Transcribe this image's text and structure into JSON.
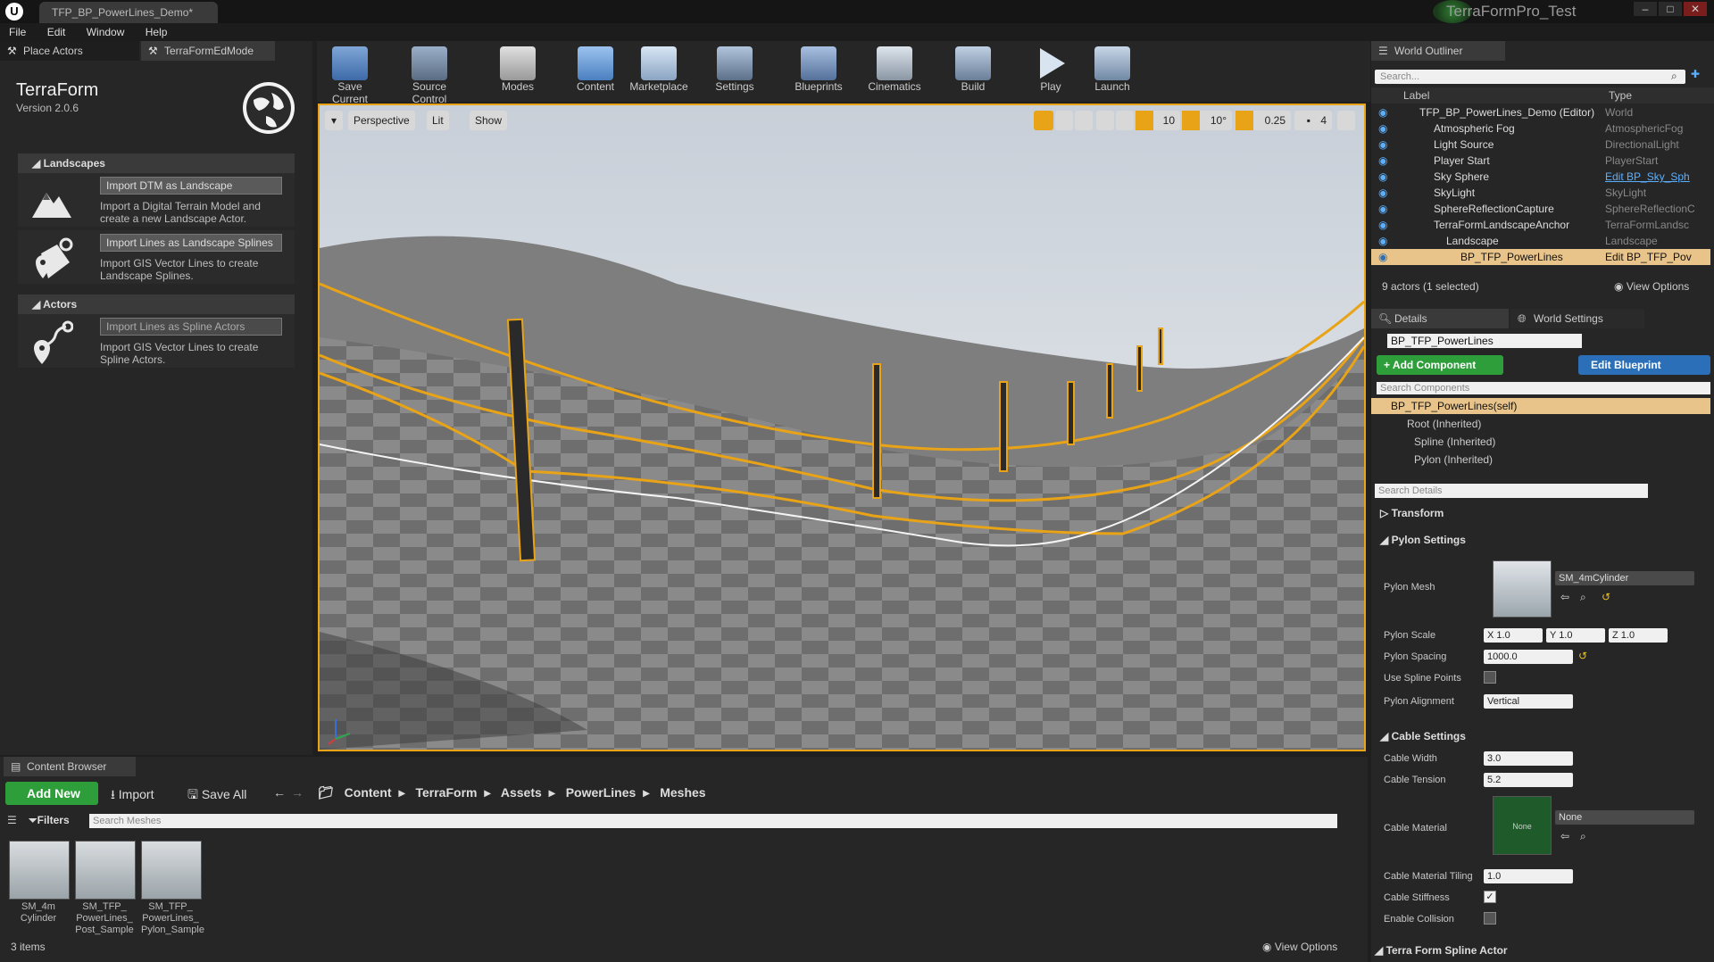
{
  "title_tab": "TFP_BP_PowerLines_Demo*",
  "project_name": "TerraFormPro_Test",
  "menu": [
    "File",
    "Edit",
    "Window",
    "Help"
  ],
  "left_tabs": [
    "Place Actors",
    "TerraFormEdMode"
  ],
  "terraform": {
    "name": "TerraForm",
    "version": "Version 2.0.6",
    "landscapes_header": "Landscapes",
    "actors_header": "Actors",
    "items": [
      {
        "button": "Import DTM as Landscape",
        "desc1": "Import a Digital Terrain Model and",
        "desc2": "create a new Landscape Actor."
      },
      {
        "button": "Import Lines as Landscape Splines",
        "desc1": "Import GIS Vector Lines to create",
        "desc2": "Landscape Splines."
      },
      {
        "button": "Import Lines as Spline Actors",
        "desc1": "Import GIS Vector Lines to create",
        "desc2": "Spline Actors."
      }
    ]
  },
  "toolbar": [
    "Save Current",
    "Source Control",
    "Modes",
    "Content",
    "Marketplace",
    "Settings",
    "Blueprints",
    "Cinematics",
    "Build",
    "Play",
    "Launch"
  ],
  "viewport": {
    "perspective": "Perspective",
    "lit": "Lit",
    "show": "Show",
    "grid": "10",
    "angle": "10°",
    "scale": "0.25",
    "camera_speed": "4"
  },
  "outliner": {
    "tab": "World Outliner",
    "search_placeholder": "Search...",
    "col_label": "Label",
    "col_type": "Type",
    "rows": [
      {
        "label": "TFP_BP_PowerLines_Demo (Editor)",
        "type": "World"
      },
      {
        "label": "Atmospheric Fog",
        "type": "AtmosphericFog"
      },
      {
        "label": "Light Source",
        "type": "DirectionalLight"
      },
      {
        "label": "Player Start",
        "type": "PlayerStart"
      },
      {
        "label": "Sky Sphere",
        "type": "Edit BP_Sky_Sph"
      },
      {
        "label": "SkyLight",
        "type": "SkyLight"
      },
      {
        "label": "SphereReflectionCapture",
        "type": "SphereReflectionC"
      },
      {
        "label": "TerraFormLandscapeAnchor",
        "type": "TerraFormLandsc"
      },
      {
        "label": "Landscape",
        "type": "Landscape"
      },
      {
        "label": "BP_TFP_PowerLines",
        "type": "Edit BP_TFP_Pov"
      }
    ],
    "status": "9 actors (1 selected)",
    "view_options": "View Options"
  },
  "details": {
    "tab": "Details",
    "tab2": "World Settings",
    "actor_name": "BP_TFP_PowerLines",
    "add_component": "+ Add Component",
    "edit_blueprint": "Edit Blueprint",
    "search_components": "Search Components",
    "self": "BP_TFP_PowerLines(self)",
    "components": [
      "Root (Inherited)",
      "Spline (Inherited)",
      "Pylon (Inherited)"
    ],
    "search_details": "Search Details",
    "transform": "Transform",
    "pylon_settings": "Pylon Settings",
    "pylon_mesh_lbl": "Pylon Mesh",
    "pylon_mesh_val": "SM_4mCylinder",
    "pylon_scale_lbl": "Pylon Scale",
    "scale_x": "X 1.0",
    "scale_y": "Y 1.0",
    "scale_z": "Z 1.0",
    "pylon_spacing_lbl": "Pylon Spacing",
    "pylon_spacing_val": "1000.0",
    "use_spline_points": "Use Spline Points",
    "pylon_alignment_lbl": "Pylon Alignment",
    "pylon_alignment_val": "Vertical",
    "cable_settings": "Cable Settings",
    "cable_width_lbl": "Cable Width",
    "cable_width_val": "3.0",
    "cable_tension_lbl": "Cable Tension",
    "cable_tension_val": "5.2",
    "cable_material_lbl": "Cable Material",
    "cable_material_val": "None",
    "cable_material_thumb": "None",
    "cable_tiling_lbl": "Cable Material Tiling",
    "cable_tiling_val": "1.0",
    "cable_stiffness": "Cable Stiffness",
    "enable_collision": "Enable Collision",
    "spline_actor": "Terra Form Spline Actor"
  },
  "content_browser": {
    "tab": "Content Browser",
    "add_new": "Add New",
    "import": "Import",
    "save_all": "Save All",
    "path": [
      "Content",
      "TerraForm",
      "Assets",
      "PowerLines",
      "Meshes"
    ],
    "filters": "Filters",
    "search_placeholder": "Search Meshes",
    "assets": [
      {
        "l1": "SM_4m",
        "l2": "Cylinder",
        "l3": ""
      },
      {
        "l1": "SM_TFP_",
        "l2": "PowerLines_",
        "l3": "Post_Sample"
      },
      {
        "l1": "SM_TFP_",
        "l2": "PowerLines_",
        "l3": "Pylon_Sample"
      }
    ],
    "count": "3 items",
    "view_options": "View Options"
  }
}
